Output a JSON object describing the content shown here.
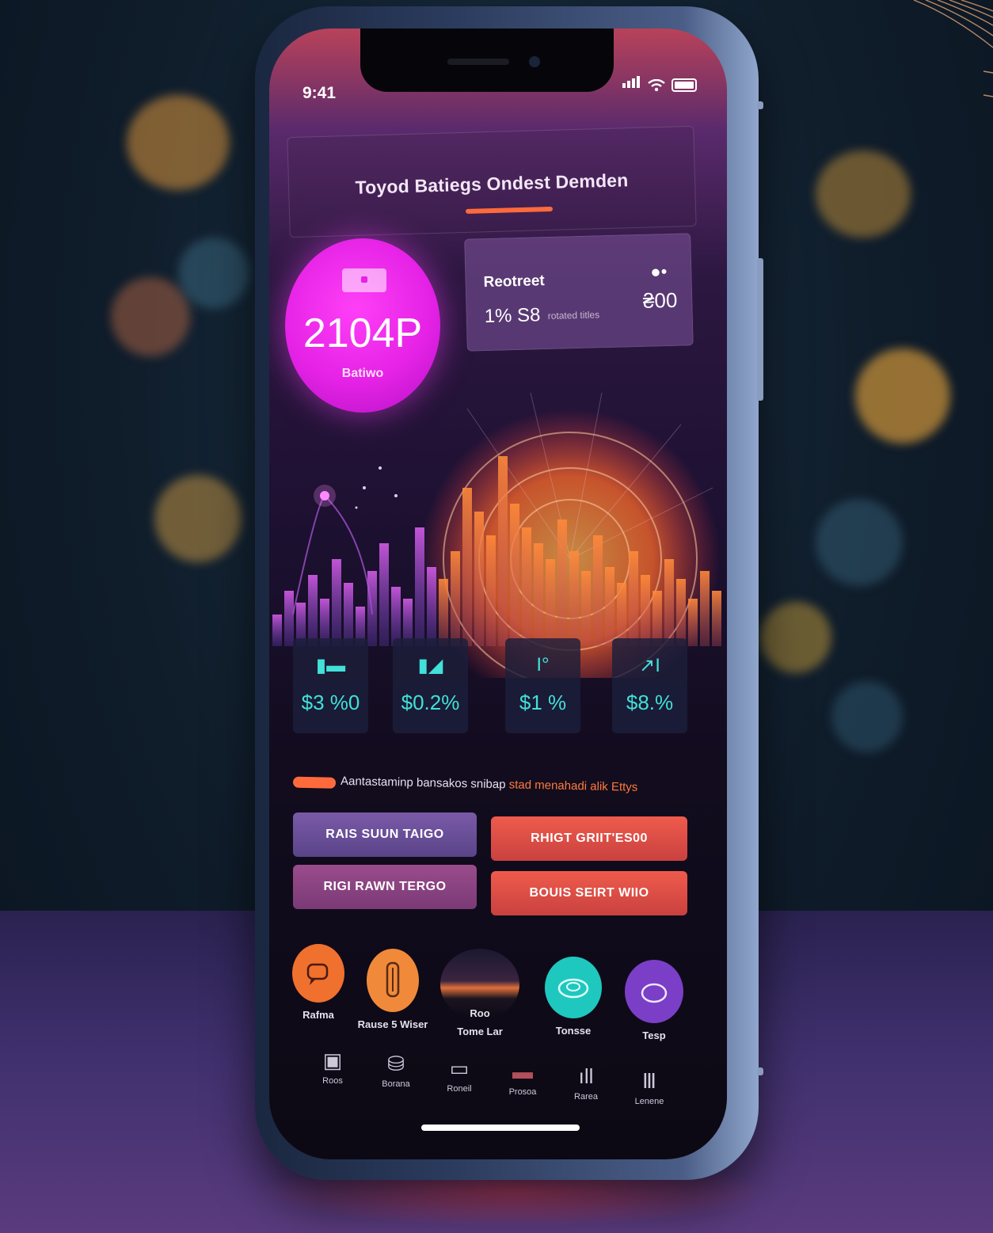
{
  "status_bar": {
    "time": "9:41"
  },
  "header": {
    "title": "Toyod Batiegs Ondest Demden"
  },
  "balance": {
    "value": "2104P",
    "label": "Batiwo"
  },
  "forecast": {
    "title": "Reotreet",
    "value": "1% S8",
    "sub_label": "rotated titles",
    "right_value": "₴00",
    "icon": "dot-menu-icon"
  },
  "stats": [
    {
      "icon": "wallet-icon",
      "icon_glyph": "▮▬",
      "value": "$3 %0"
    },
    {
      "icon": "users-icon",
      "icon_glyph": "▮◢",
      "value": "$0.2%"
    },
    {
      "icon": "trend-icon",
      "icon_glyph": "I°",
      "value": "$1 %"
    },
    {
      "icon": "chart-icon",
      "icon_glyph": "↗I",
      "value": "$8.%"
    }
  ],
  "promo": {
    "text": "Aantastaminp bansakos snibap",
    "highlight": "stad menahadi alik Ettys"
  },
  "actions": [
    {
      "label": "RAIS SUUN TAIGO",
      "style": "purple"
    },
    {
      "label": "RHIGT GRIIT'ES00",
      "style": "red"
    },
    {
      "label": "RIGI RAWN TERGO",
      "style": "pink"
    },
    {
      "label": "BOUIS SEIRT WIIO",
      "style": "red"
    }
  ],
  "shortcuts": [
    {
      "label": "Rafma",
      "icon": "chat-icon",
      "color": "#f0702e"
    },
    {
      "label": "Rause 5 Wiser",
      "icon": "bottle-icon",
      "color": "#f08a3a"
    },
    {
      "label": "Tome Lar",
      "sub": "Roo",
      "icon": "sunset-image-icon",
      "color": "#24213a"
    },
    {
      "label": "Tonsse",
      "icon": "cloud-icon",
      "color": "#1fc8be"
    },
    {
      "label": "Tesp",
      "icon": "ring-icon",
      "color": "#7a3fc6"
    }
  ],
  "tabs": [
    {
      "label": "Roos",
      "icon": "calendar-icon",
      "glyph": "▣"
    },
    {
      "label": "Borana",
      "icon": "briefcase-icon",
      "glyph": "⛁"
    },
    {
      "label": "Roneil",
      "icon": "monitor-icon",
      "glyph": "▭"
    },
    {
      "label": "Prosoa",
      "icon": "books-icon",
      "glyph": "▬"
    },
    {
      "label": "Rarea",
      "icon": "bars-icon",
      "glyph": "ıll"
    },
    {
      "label": "Lenene",
      "icon": "library-icon",
      "glyph": "Ⅲ"
    }
  ],
  "colors": {
    "accent_pink": "#e522e6",
    "accent_orange": "#ff6a3d",
    "accent_teal": "#41e0d8"
  }
}
